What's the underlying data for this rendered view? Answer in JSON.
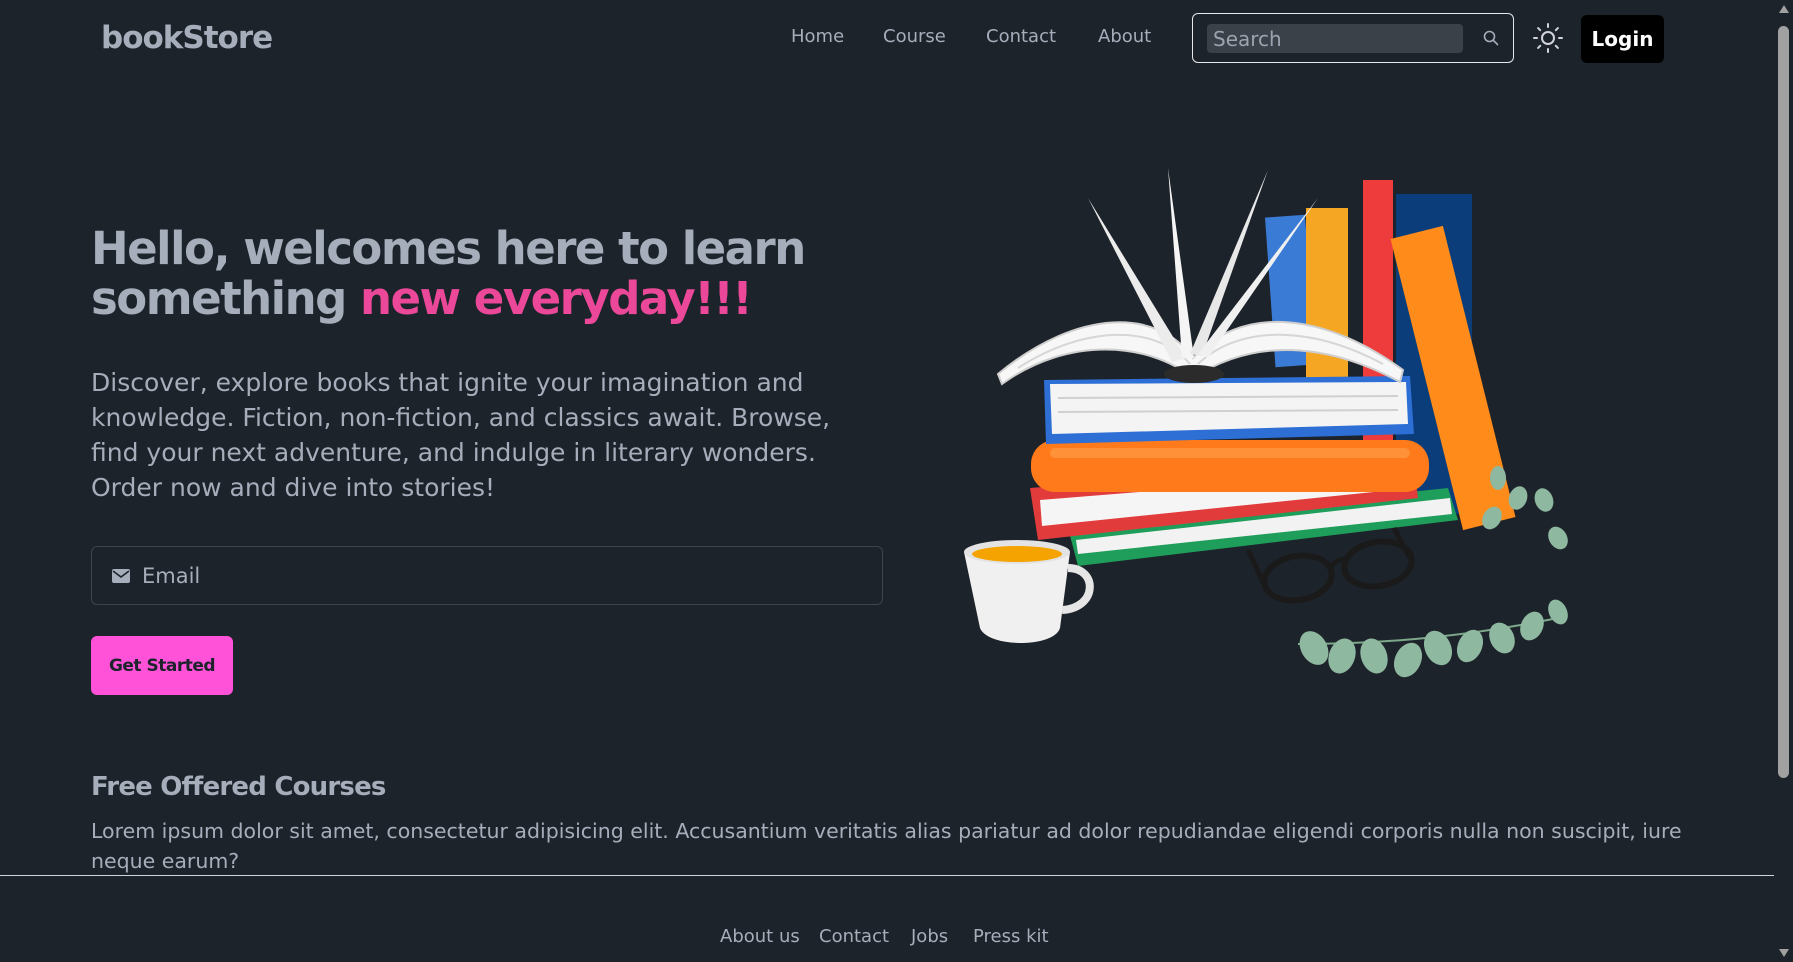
{
  "header": {
    "logo": "bookStore",
    "nav": [
      "Home",
      "Course",
      "Contact",
      "About"
    ],
    "search_placeholder": "Search",
    "login_label": "Login"
  },
  "hero": {
    "title_main": "Hello, welcomes here to learn something ",
    "title_accent": "new everyday!!!",
    "description": "Discover, explore books that ignite your imagination and knowledge. Fiction, non-fiction, and classics await. Browse, find your next adventure, and indulge in literary wonders. Order now and dive into stories!",
    "email_placeholder": "Email",
    "cta_label": "Get Started"
  },
  "courses": {
    "title": "Free Offered Courses",
    "description": "Lorem ipsum dolor sit amet, consectetur adipisicing elit. Accusantium veritatis alias pariatur ad dolor repudiandae eligendi corporis nulla non suscipit, iure neque earum?"
  },
  "footer": {
    "links": [
      "About us",
      "Contact",
      "Jobs",
      "Press kit"
    ]
  },
  "colors": {
    "background": "#1d232a",
    "text": "#a6adbb",
    "accent": "#ec4899",
    "cta": "#ff52d9",
    "login_bg": "#000000"
  },
  "icons": {
    "search": "search-icon",
    "theme": "sun-icon",
    "mail": "mail-icon"
  }
}
